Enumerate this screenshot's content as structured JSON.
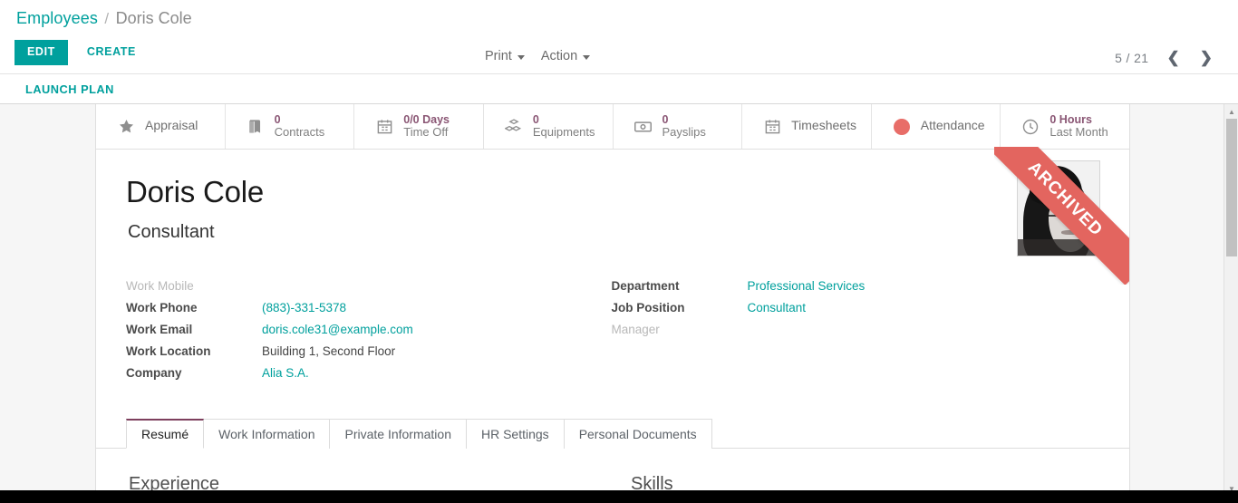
{
  "breadcrumb": {
    "root": "Employees",
    "separator": "/",
    "current": "Doris Cole"
  },
  "control_panel": {
    "edit_label": "EDIT",
    "create_label": "CREATE",
    "print_label": "Print",
    "action_label": "Action",
    "pager_text": "5 / 21",
    "prev_icon": "chevron-left-icon",
    "next_icon": "chevron-right-icon"
  },
  "launch_bar": {
    "label": "LAUNCH PLAN"
  },
  "stat_buttons": [
    {
      "icon": "star-icon",
      "value": "",
      "label": "Appraisal"
    },
    {
      "icon": "book-icon",
      "value": "0",
      "label": "Contracts"
    },
    {
      "icon": "calendar-icon",
      "value": "0/0 Days",
      "label": "Time Off"
    },
    {
      "icon": "boxes-icon",
      "value": "0",
      "label": "Equipments"
    },
    {
      "icon": "money-icon",
      "value": "0",
      "label": "Payslips"
    },
    {
      "icon": "calendar-icon",
      "value": "",
      "label": "Timesheets"
    },
    {
      "icon": "red-dot-icon",
      "value": "",
      "label": "Attendance"
    },
    {
      "icon": "clock-icon",
      "value": "0 Hours",
      "label": "Last Month"
    }
  ],
  "record": {
    "name": "Doris Cole",
    "job_title": "Consultant",
    "ribbon_label": "ARCHIVED",
    "avatar_alt": "employee-photo"
  },
  "fields_left": [
    {
      "label": "Work Mobile",
      "value": "",
      "empty": true,
      "link": false
    },
    {
      "label": "Work Phone",
      "value": "(883)-331-5378",
      "empty": false,
      "link": true
    },
    {
      "label": "Work Email",
      "value": "doris.cole31@example.com",
      "empty": false,
      "link": true
    },
    {
      "label": "Work Location",
      "value": "Building 1, Second Floor",
      "empty": false,
      "link": false
    },
    {
      "label": "Company",
      "value": "Alia S.A.",
      "empty": false,
      "link": true
    }
  ],
  "fields_right": [
    {
      "label": "Department",
      "value": "Professional Services",
      "empty": false,
      "link": true
    },
    {
      "label": "Job Position",
      "value": "Consultant",
      "empty": false,
      "link": true
    },
    {
      "label": "Manager",
      "value": "",
      "empty": true,
      "link": false
    }
  ],
  "notebook": {
    "tabs": [
      {
        "label": "Resumé",
        "active": true
      },
      {
        "label": "Work Information",
        "active": false
      },
      {
        "label": "Private Information",
        "active": false
      },
      {
        "label": "HR Settings",
        "active": false
      },
      {
        "label": "Personal Documents",
        "active": false
      }
    ],
    "left_heading": "Experience",
    "right_heading": "Skills"
  },
  "colors": {
    "accent_teal": "#00a09d",
    "stat_value_purple": "#8a5674",
    "ribbon_red": "#e3655f",
    "attendance_dot": "#e86d68",
    "active_tab_border": "#7d3f5d"
  }
}
